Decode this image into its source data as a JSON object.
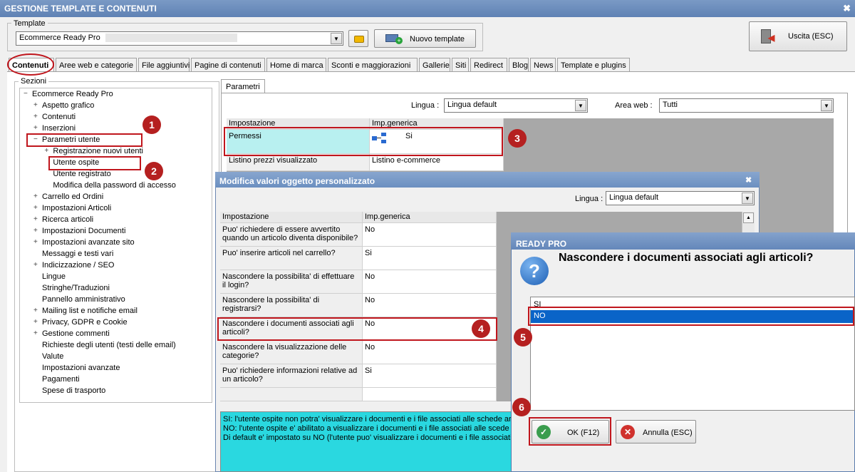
{
  "window": {
    "title": "GESTIONE TEMPLATE E CONTENUTI",
    "close": "✖"
  },
  "template": {
    "group_label": "Template",
    "selected": "Ecommerce Ready Pro",
    "new_button": "Nuovo template",
    "exit_button": "Uscita (ESC)"
  },
  "tabs": [
    "Contenuti",
    "Aree web e categorie",
    "File aggiuntivi",
    "Pagine di contenuti",
    "Home di marca",
    "Sconti e maggiorazioni",
    "Gallerie",
    "Siti",
    "Redirect",
    "Blog",
    "News",
    "Template e plugins"
  ],
  "sections": {
    "label": "Sezioni",
    "root": "Ecommerce Ready Pro",
    "items": [
      {
        "label": "Aspetto grafico",
        "pm": "+",
        "indent": 1
      },
      {
        "label": "Contenuti",
        "pm": "+",
        "indent": 1
      },
      {
        "label": "Inserzioni",
        "pm": "+",
        "indent": 1
      },
      {
        "label": "Parametri utente",
        "pm": "−",
        "indent": 1
      },
      {
        "label": "Registrazione nuovi utenti",
        "pm": "+",
        "indent": 2
      },
      {
        "label": "Utente ospite",
        "pm": "",
        "indent": 2
      },
      {
        "label": "Utente registrato",
        "pm": "",
        "indent": 2
      },
      {
        "label": "Modifica della password di accesso",
        "pm": "",
        "indent": 2
      },
      {
        "label": "Carrello ed Ordini",
        "pm": "+",
        "indent": 1
      },
      {
        "label": "Impostazioni Articoli",
        "pm": "+",
        "indent": 1
      },
      {
        "label": "Ricerca articoli",
        "pm": "+",
        "indent": 1
      },
      {
        "label": "Impostazioni Documenti",
        "pm": "+",
        "indent": 1
      },
      {
        "label": "Impostazioni avanzate sito",
        "pm": "+",
        "indent": 1
      },
      {
        "label": "Messaggi e testi vari",
        "pm": "",
        "indent": 1
      },
      {
        "label": "Indicizzazione / SEO",
        "pm": "+",
        "indent": 1
      },
      {
        "label": "Lingue",
        "pm": "",
        "indent": 1
      },
      {
        "label": "Stringhe/Traduzioni",
        "pm": "",
        "indent": 1
      },
      {
        "label": "Pannello amministrativo",
        "pm": "",
        "indent": 1
      },
      {
        "label": "Mailing list e notifiche email",
        "pm": "+",
        "indent": 1
      },
      {
        "label": "Privacy, GDPR e Cookie",
        "pm": "+",
        "indent": 1
      },
      {
        "label": "Gestione commenti",
        "pm": "+",
        "indent": 1
      },
      {
        "label": "Richieste degli utenti (testi delle email)",
        "pm": "",
        "indent": 1
      },
      {
        "label": "Valute",
        "pm": "",
        "indent": 1
      },
      {
        "label": "Impostazioni avanzate",
        "pm": "",
        "indent": 1
      },
      {
        "label": "Pagamenti",
        "pm": "",
        "indent": 1
      },
      {
        "label": "Spese di trasporto",
        "pm": "",
        "indent": 1
      }
    ]
  },
  "params": {
    "tab": "Parametri",
    "lingua_label": "Lingua :",
    "lingua_value": "Lingua default",
    "area_label": "Area web :",
    "area_value": "Tutti",
    "col_setting": "Impostazione",
    "col_generic": "Imp.generica",
    "rows": [
      {
        "label": "Permessi",
        "value": "Si"
      },
      {
        "label": "Listino prezzi visualizzato",
        "value": "Listino e-commerce"
      }
    ]
  },
  "edit_dialog": {
    "title": "Modifica valori oggetto personalizzato",
    "close": "✖",
    "lingua_label": "Lingua :",
    "lingua_value": "Lingua default",
    "col_setting": "Impostazione",
    "col_generic": "Imp.generica",
    "rows": [
      {
        "label": "Puo' richiedere di essere avvertito quando un articolo diventa disponibile?",
        "value": "No"
      },
      {
        "label": "Puo' inserire articoli nel carrello?",
        "value": "Si"
      },
      {
        "label": "Nascondere la possibilita' di effettuare il login?",
        "value": "No"
      },
      {
        "label": "Nascondere la possibilita' di registrarsi?",
        "value": "No"
      },
      {
        "label": "Nascondere i documenti associati agli articoli?",
        "value": "No"
      },
      {
        "label": "Nascondere la visualizzazione delle categorie?",
        "value": "No"
      },
      {
        "label": "Puo' richiedere informazioni relative ad un articolo?",
        "value": "Si"
      }
    ],
    "description": [
      "SI: l'utente ospite non potra' visualizzare i documenti e i file associati alle schede artic",
      "NO: l'utente ospite e' abilitato a visualizzare i documenti e i file associati alle scede art",
      "Di default e' impostato su NO (l'utente puo' visualizzare i documenti e i file associati al"
    ]
  },
  "ready_dialog": {
    "title": "READY PRO",
    "question": "Nascondere i documenti associati agli articoli?",
    "options": [
      "SI",
      "NO"
    ],
    "selected": "NO",
    "ok": "OK (F12)",
    "cancel": "Annulla (ESC)"
  },
  "markers": [
    "1",
    "2",
    "3",
    "4",
    "5",
    "6"
  ],
  "colors": {
    "accent_red": "#c0161d",
    "selection": "#0a64c8",
    "highlight": "#b8f0f0",
    "desc_bg": "#2ad8e0"
  }
}
